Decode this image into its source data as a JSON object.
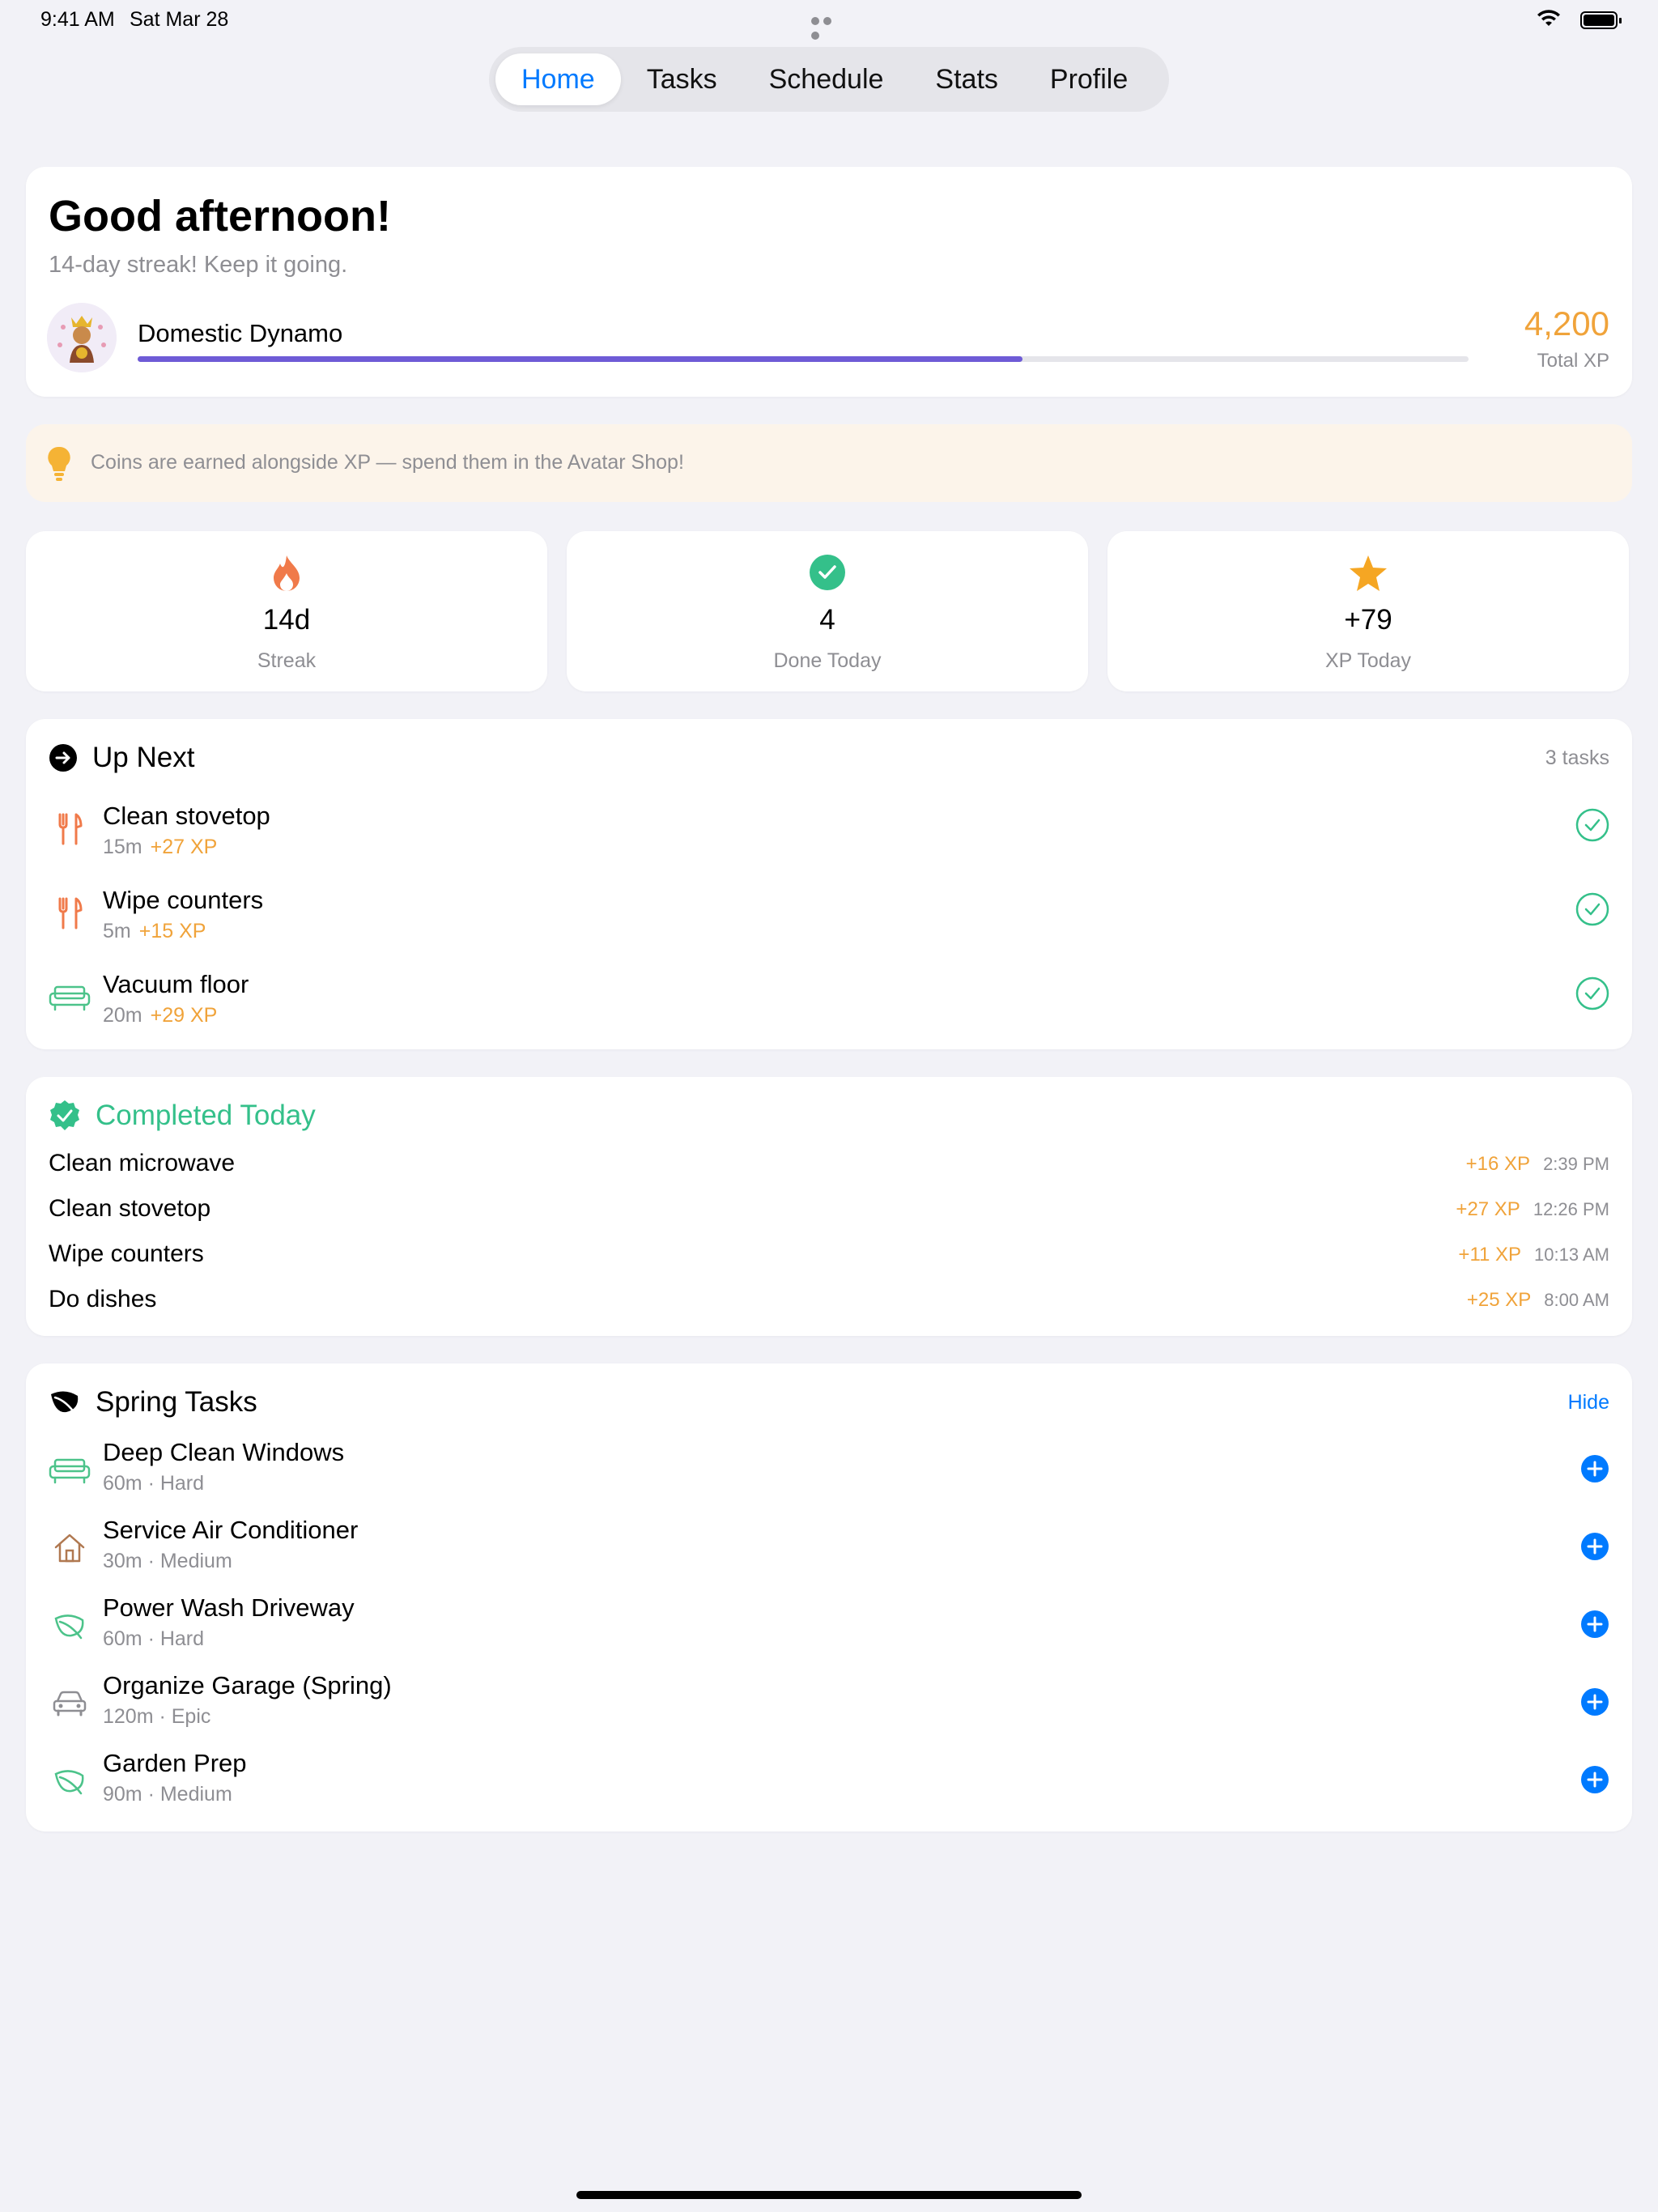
{
  "status_bar": {
    "time": "9:41 AM",
    "date": "Sat Mar 28"
  },
  "tabs": [
    {
      "label": "Home",
      "active": true
    },
    {
      "label": "Tasks",
      "active": false
    },
    {
      "label": "Schedule",
      "active": false
    },
    {
      "label": "Stats",
      "active": false
    },
    {
      "label": "Profile",
      "active": false
    }
  ],
  "greeting": {
    "title": "Good afternoon!",
    "subtitle": "14-day streak! Keep it going.",
    "level_name": "Domestic Dynamo",
    "level_progress": 0.665,
    "total_xp": "4,200",
    "total_xp_label": "Total XP"
  },
  "tip": {
    "icon": "lightbulb-icon",
    "text": "Coins are earned alongside XP — spend them in the Avatar Shop!"
  },
  "stats": [
    {
      "icon": "flame-icon",
      "value": "14d",
      "label": "Streak"
    },
    {
      "icon": "check-circle-icon",
      "value": "4",
      "label": "Done Today"
    },
    {
      "icon": "star-icon",
      "value": "+79",
      "label": "XP Today"
    }
  ],
  "up_next": {
    "title": "Up Next",
    "count": "3 tasks",
    "items": [
      {
        "icon": "fork-knife-icon",
        "name": "Clean stovetop",
        "duration": "15m",
        "xp": "+27 XP"
      },
      {
        "icon": "fork-knife-icon",
        "name": "Wipe counters",
        "duration": "5m",
        "xp": "+15 XP"
      },
      {
        "icon": "sofa-icon",
        "name": "Vacuum floor",
        "duration": "20m",
        "xp": "+29 XP"
      }
    ]
  },
  "completed": {
    "title": "Completed Today",
    "items": [
      {
        "name": "Clean microwave",
        "xp": "+16 XP",
        "time": "2:39 PM"
      },
      {
        "name": "Clean stovetop",
        "xp": "+27 XP",
        "time": "12:26 PM"
      },
      {
        "name": "Wipe counters",
        "xp": "+11 XP",
        "time": "10:13 AM"
      },
      {
        "name": "Do dishes",
        "xp": "+25 XP",
        "time": "8:00 AM"
      }
    ]
  },
  "spring": {
    "title": "Spring Tasks",
    "hide_label": "Hide",
    "items": [
      {
        "icon": "sofa-icon",
        "name": "Deep Clean Windows",
        "meta": "60m · Hard"
      },
      {
        "icon": "house-icon",
        "name": "Service Air Conditioner",
        "meta": "30m · Medium"
      },
      {
        "icon": "leaf-icon",
        "name": "Power Wash Driveway",
        "meta": "60m · Hard"
      },
      {
        "icon": "car-icon",
        "name": "Organize Garage (Spring)",
        "meta": "120m · Epic"
      },
      {
        "icon": "leaf-icon",
        "name": "Garden Prep",
        "meta": "90m · Medium"
      }
    ]
  },
  "colors": {
    "accent": "#007AFF",
    "xp": "#F0A33A",
    "success": "#34C08A",
    "progress": "#6E5BD6",
    "flame": "#F07A4A",
    "background": "#F2F2F7"
  }
}
